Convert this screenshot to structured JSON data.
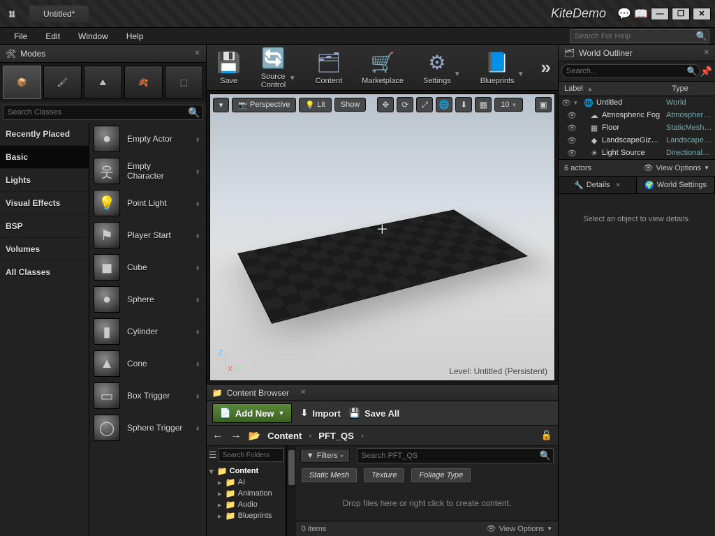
{
  "titlebar": {
    "tab": "Untitled*",
    "project": "KiteDemo",
    "win": {
      "min": "—",
      "max": "❐",
      "close": "✕"
    }
  },
  "menubar": {
    "items": [
      "File",
      "Edit",
      "Window",
      "Help"
    ],
    "help_search_placeholder": "Search For Help"
  },
  "modes": {
    "tab_label": "Modes",
    "search_placeholder": "Search Classes",
    "categories": [
      "Recently Placed",
      "Basic",
      "Lights",
      "Visual Effects",
      "BSP",
      "Volumes",
      "All Classes"
    ],
    "active_category": 1,
    "actors": [
      {
        "label": "Empty Actor",
        "glyph": "●"
      },
      {
        "label": "Empty Character",
        "glyph": "웃"
      },
      {
        "label": "Point Light",
        "glyph": "💡"
      },
      {
        "label": "Player Start",
        "glyph": "⚑"
      },
      {
        "label": "Cube",
        "glyph": "◼"
      },
      {
        "label": "Sphere",
        "glyph": "●"
      },
      {
        "label": "Cylinder",
        "glyph": "▮"
      },
      {
        "label": "Cone",
        "glyph": "▲"
      },
      {
        "label": "Box Trigger",
        "glyph": "▭"
      },
      {
        "label": "Sphere Trigger",
        "glyph": "◯"
      }
    ]
  },
  "toolbar": {
    "save": "Save",
    "source_control": "Source Control",
    "content": "Content",
    "marketplace": "Marketplace",
    "settings": "Settings",
    "blueprints": "Blueprints"
  },
  "viewport": {
    "menu_btn": "▾",
    "perspective": "Perspective",
    "lit": "Lit",
    "show": "Show",
    "snap_value": "10",
    "level_text": "Level:  Untitled (Persistent)",
    "axes": {
      "z": "Z",
      "x": "X",
      "y": "Y"
    }
  },
  "content_browser": {
    "tab": "Content Browser",
    "add_new": "Add New",
    "import": "Import",
    "save_all": "Save All",
    "path": [
      "Content",
      "PFT_QS"
    ],
    "tree_search_placeholder": "Search Folders",
    "tree": {
      "root": "Content",
      "children": [
        "AI",
        "Animation",
        "Audio",
        "Blueprints"
      ]
    },
    "filters_label": "Filters",
    "asset_search_placeholder": "Search PFT_QS",
    "chips": [
      "Static Mesh",
      "Texture",
      "Foliage Type"
    ],
    "drop_hint": "Drop files here or right click to create content.",
    "item_count": "0 items",
    "view_options": "View Options"
  },
  "outliner": {
    "tab": "World Outliner",
    "search_placeholder": "Search...",
    "columns": {
      "label": "Label",
      "type": "Type"
    },
    "rows": [
      {
        "name": "Untitled",
        "type": "World",
        "icon": "🌐",
        "root": true
      },
      {
        "name": "Atmospheric Fog",
        "type": "AtmosphericFog",
        "icon": "☁"
      },
      {
        "name": "Floor",
        "type": "StaticMeshActor",
        "icon": "▦"
      },
      {
        "name": "LandscapeGizmoActiveActor",
        "type": "LandscapeGizmo",
        "icon": "◆"
      },
      {
        "name": "Light Source",
        "type": "DirectionalLight",
        "icon": "☀"
      }
    ],
    "actor_count": "6 actors",
    "view_options": "View Options"
  },
  "details": {
    "tab_details": "Details",
    "tab_world": "World Settings",
    "empty_hint": "Select an object to view details."
  }
}
